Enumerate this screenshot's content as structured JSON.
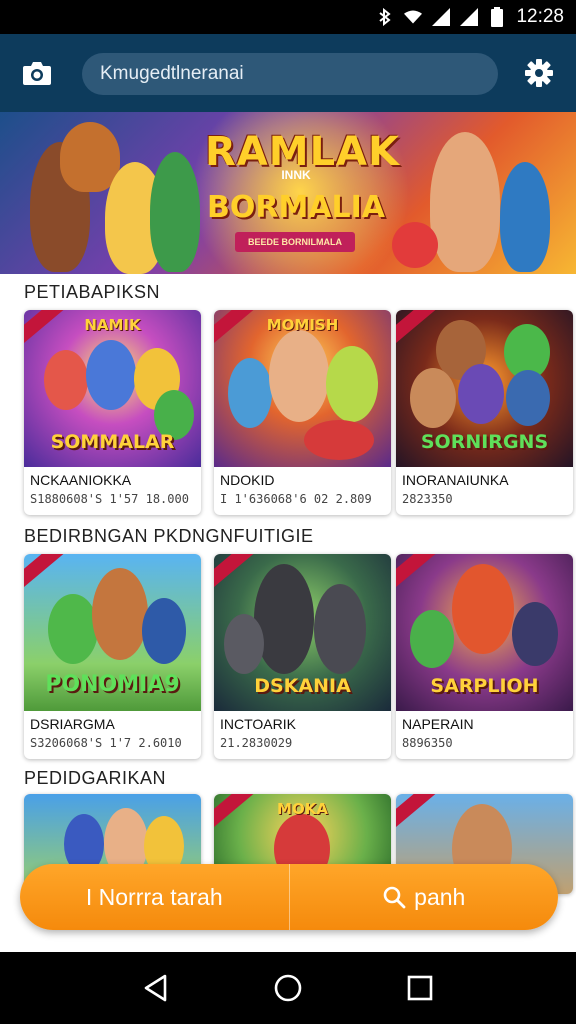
{
  "status_bar": {
    "time": "12:28",
    "icons": [
      "bluetooth-icon",
      "wifi-icon",
      "signal-icon",
      "signal-icon",
      "battery-icon"
    ]
  },
  "app_bar": {
    "search_text": "Kmugedtlneranai",
    "left_icon": "camera-icon",
    "right_icon": "settings-icon"
  },
  "hero": {
    "title_line1": "RAMLAK",
    "title_small": "INNK",
    "title_line2": "BORMALIA",
    "ribbon": "BEEDE BORNILMALA"
  },
  "sections": [
    {
      "title": "PETIABAPIKSN",
      "cards": [
        {
          "art_top": "NAMIK",
          "art_title": "SOMMALAR",
          "name": "NCKAANIOKKA",
          "meta": "S1880608'S 1'57 18.000"
        },
        {
          "art_top": "MOMISH",
          "art_title": "",
          "name": "NDOKID",
          "meta": "I 1'636068'6 02 2.809"
        },
        {
          "art_top": "",
          "art_title": "SORNIRGNS",
          "name": "INORANAIUNKA",
          "meta": "2823350"
        }
      ]
    },
    {
      "title": "BEDIRBNGAN PKDNGNFUITIGIE",
      "cards": [
        {
          "art_top": "",
          "art_title": "PONOMIA9",
          "name": "DSRIARGMA",
          "meta": "S3206068'S 1'7 2.6010"
        },
        {
          "art_top": "",
          "art_title": "DSKANIA",
          "name": "INCTOARIK",
          "meta": "21.2830029"
        },
        {
          "art_top": "",
          "art_title": "SARPLIOH",
          "name": "NAPERAIN",
          "meta": "8896350"
        }
      ]
    },
    {
      "title": "PEDIDGARIKAN",
      "cards": [
        {
          "art_top": "",
          "art_title": "",
          "name": "",
          "meta": ""
        },
        {
          "art_top": "MOKA",
          "art_title": "",
          "name": "",
          "meta": ""
        },
        {
          "art_top": "",
          "art_title": "",
          "name": "",
          "meta": ""
        }
      ]
    }
  ],
  "cta": {
    "left_label": "I Norrra tarah",
    "right_label": "panh",
    "right_icon": "search-icon"
  },
  "nav": {
    "back": "back-icon",
    "home": "home-icon",
    "recents": "recents-icon"
  },
  "colors": {
    "app_bar": "#0d3b5c",
    "search_box": "#2e5878",
    "cta": "#f7931e",
    "status_bar": "#000000"
  }
}
